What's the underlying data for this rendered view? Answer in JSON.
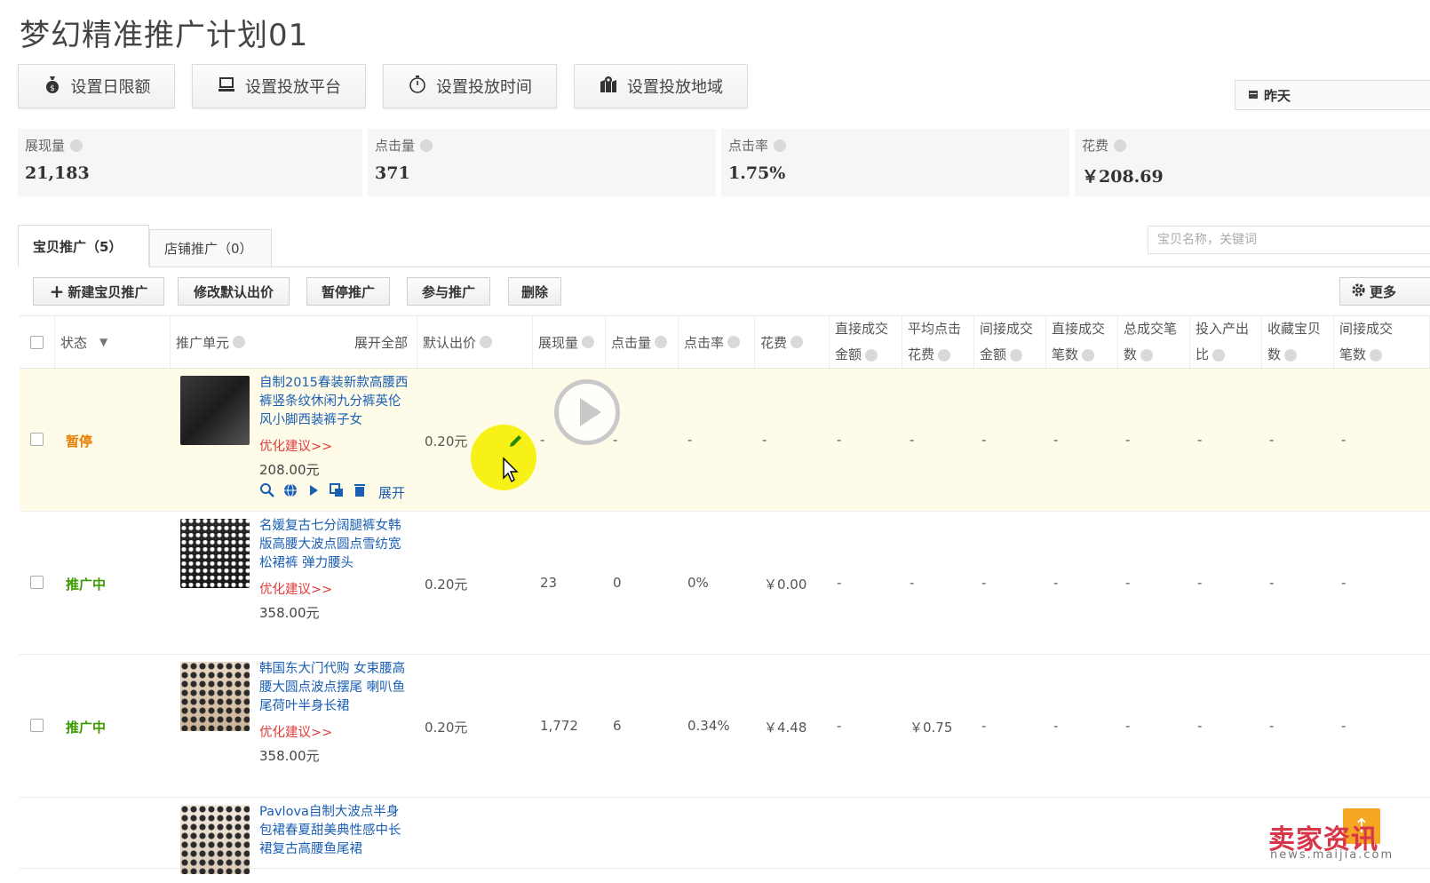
{
  "page_title": "梦幻精准推广计划01",
  "settings_buttons": [
    {
      "label": "设置日限额",
      "icon": "money-bag-icon"
    },
    {
      "label": "设置投放平台",
      "icon": "laptop-icon"
    },
    {
      "label": "设置投放时间",
      "icon": "stopwatch-icon"
    },
    {
      "label": "设置投放地域",
      "icon": "map-pin-icon"
    }
  ],
  "date_range": "昨天",
  "metrics": [
    {
      "label": "展现量",
      "value": "21,183"
    },
    {
      "label": "点击量",
      "value": "371"
    },
    {
      "label": "点击率",
      "value": "1.75%"
    },
    {
      "label": "花费",
      "value": "￥208.69"
    }
  ],
  "tabs": [
    {
      "label": "宝贝推广（5）"
    },
    {
      "label": "店铺推广（0）"
    }
  ],
  "search_placeholder": "宝贝名称，关键词",
  "actions": {
    "new_label": "新建宝贝推广",
    "modify_bid_label": "修改默认出价",
    "pause_label": "暂停推广",
    "join_label": "参与推广",
    "delete_label": "删除",
    "more_label": "更多"
  },
  "table": {
    "headers": {
      "status": "状态",
      "unit": "推广单元",
      "expand_all": "展开全部",
      "default_bid": "默认出价",
      "impressions": "展现量",
      "clicks": "点击量",
      "ctr": "点击率",
      "cost": "花费",
      "direct_amount_1": "直接成交",
      "direct_amount_2": "金额",
      "avg_click_1": "平均点击",
      "avg_click_2": "花费",
      "indirect_amount_1": "间接成交",
      "indirect_amount_2": "金额",
      "direct_count_1": "直接成交",
      "direct_count_2": "笔数",
      "total_count_1": "总成交笔",
      "total_count_2": "数",
      "roi_1": "投入产出",
      "roi_2": "比",
      "fav_1": "收藏宝贝",
      "fav_2": "数",
      "indirect_count_1": "间接成交",
      "indirect_count_2": "笔数"
    },
    "optimize_label": "优化建议>>",
    "expand_label": "展开",
    "rows": [
      {
        "status": "暂停",
        "title": "自制2015春装新款高腰西裤竖条纹休闲九分裤英伦风小脚西装裤子女",
        "price": "208.00元",
        "bid": "0.20元",
        "impressions": "-",
        "clicks": "-",
        "ctr": "-",
        "cost": "-",
        "direct_amount": "-",
        "avg_click": "-",
        "indirect_amount": "-",
        "direct_count": "-",
        "total_count": "-",
        "roi": "-",
        "fav": "-",
        "indirect_count": "-"
      },
      {
        "status": "推广中",
        "title": "名媛复古七分阔腿裤女韩版高腰大波点圆点雪纺宽松裙裤 弹力腰头",
        "price": "358.00元",
        "bid": "0.20元",
        "impressions": "23",
        "clicks": "0",
        "ctr": "0%",
        "cost": "￥0.00",
        "direct_amount": "-",
        "avg_click": "-",
        "indirect_amount": "-",
        "direct_count": "-",
        "total_count": "-",
        "roi": "-",
        "fav": "-",
        "indirect_count": "-"
      },
      {
        "status": "推广中",
        "title": "韩国东大门代购 女束腰高腰大圆点波点摆尾 喇叭鱼尾荷叶半身长裙",
        "price": "358.00元",
        "bid": "0.20元",
        "impressions": "1,772",
        "clicks": "6",
        "ctr": "0.34%",
        "cost": "￥4.48",
        "direct_amount": "-",
        "avg_click": "￥0.75",
        "indirect_amount": "-",
        "direct_count": "-",
        "total_count": "-",
        "roi": "-",
        "fav": "-",
        "indirect_count": "-"
      },
      {
        "status": "",
        "title": "Pavlova自制大波点半身包裙春夏甜美典性感中长裙复古高腰鱼尾裙",
        "price": "",
        "bid": ""
      }
    ]
  },
  "watermark": {
    "text": "卖家资讯",
    "url": "news.maijia.com"
  }
}
